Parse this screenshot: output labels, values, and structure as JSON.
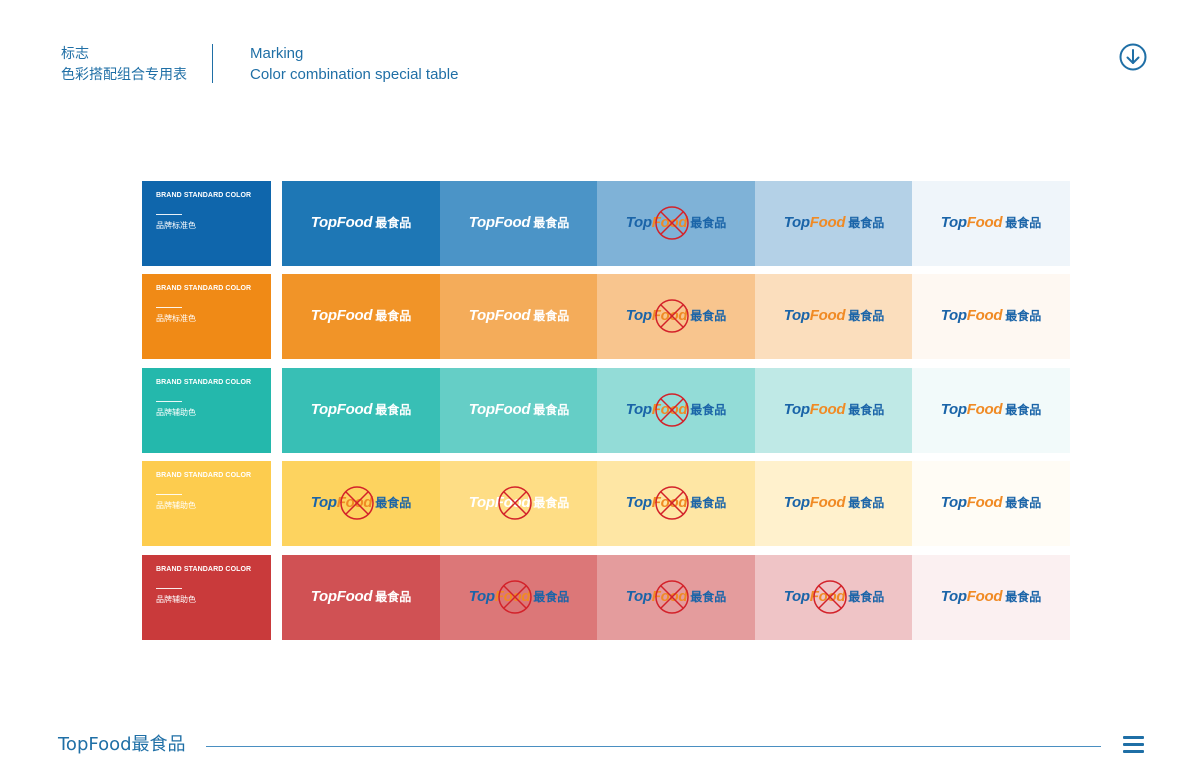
{
  "header": {
    "cn_line1": "标志",
    "cn_line2": "色彩搭配组合专用表",
    "en_line1": "Marking",
    "en_line2": "Color combination special table",
    "download_icon": "arrow-down-circle-icon"
  },
  "logo": {
    "en_part1": "Top",
    "en_part2": "Food",
    "cn_part": "最食品"
  },
  "colors": {
    "brand_blue": "#1a64a8",
    "brand_orange": "#f08a24",
    "prohibited_red": "#d3222a"
  },
  "rows": [
    {
      "label_en": "BRAND STANDARD COLOR",
      "label_cn": "品牌标准色",
      "base_color": "#0f66ac",
      "swatches": [
        {
          "bg": "#1e77b5",
          "logo_style": "white",
          "prohibited": false
        },
        {
          "bg": "#4b94c7",
          "logo_style": "white",
          "prohibited": false
        },
        {
          "bg": "#7fb2d7",
          "logo_style": "color",
          "prohibited": true
        },
        {
          "bg": "#b4d1e7",
          "logo_style": "color",
          "prohibited": false
        },
        {
          "bg": "#eff5fa",
          "logo_style": "color",
          "prohibited": false
        }
      ]
    },
    {
      "label_en": "BRAND STANDARD COLOR",
      "label_cn": "品牌标准色",
      "base_color": "#f08a16",
      "swatches": [
        {
          "bg": "#f19428",
          "logo_style": "white",
          "prohibited": false
        },
        {
          "bg": "#f4ac5a",
          "logo_style": "white",
          "prohibited": false
        },
        {
          "bg": "#f8c58e",
          "logo_style": "color",
          "prohibited": true
        },
        {
          "bg": "#fbdebd",
          "logo_style": "color",
          "prohibited": false
        },
        {
          "bg": "#fef8f2",
          "logo_style": "color",
          "prohibited": false
        }
      ]
    },
    {
      "label_en": "BRAND STANDARD COLOR",
      "label_cn": "品牌辅助色",
      "base_color": "#24b8ac",
      "swatches": [
        {
          "bg": "#38bfb5",
          "logo_style": "white",
          "prohibited": false
        },
        {
          "bg": "#65cec6",
          "logo_style": "white",
          "prohibited": false
        },
        {
          "bg": "#93dcd7",
          "logo_style": "color",
          "prohibited": true
        },
        {
          "bg": "#bfe9e6",
          "logo_style": "color",
          "prohibited": false
        },
        {
          "bg": "#f2fafa",
          "logo_style": "color",
          "prohibited": false
        }
      ]
    },
    {
      "label_en": "BRAND STANDARD COLOR",
      "label_cn": "品牌辅助色",
      "base_color": "#fdcc4e",
      "swatches": [
        {
          "bg": "#fdd35f",
          "logo_style": "color",
          "prohibited": true
        },
        {
          "bg": "#fedd85",
          "logo_style": "white",
          "prohibited": true
        },
        {
          "bg": "#fee6a4",
          "logo_style": "color",
          "prohibited": true
        },
        {
          "bg": "#fff1cd",
          "logo_style": "color",
          "prohibited": false
        },
        {
          "bg": "#fffcf5",
          "logo_style": "color",
          "prohibited": false
        }
      ]
    },
    {
      "label_en": "BRAND STANDARD COLOR",
      "label_cn": "品牌辅助色",
      "base_color": "#c93a3b",
      "swatches": [
        {
          "bg": "#d05154",
          "logo_style": "white",
          "prohibited": false
        },
        {
          "bg": "#dc7778",
          "logo_style": "color",
          "prohibited": true
        },
        {
          "bg": "#e49c9d",
          "logo_style": "color",
          "prohibited": true
        },
        {
          "bg": "#efc4c6",
          "logo_style": "color",
          "prohibited": true
        },
        {
          "bg": "#fbf0f1",
          "logo_style": "color",
          "prohibited": false
        }
      ]
    }
  ],
  "footer": {
    "brand": "TopFood最食品",
    "menu_icon": "hamburger-menu-icon"
  }
}
